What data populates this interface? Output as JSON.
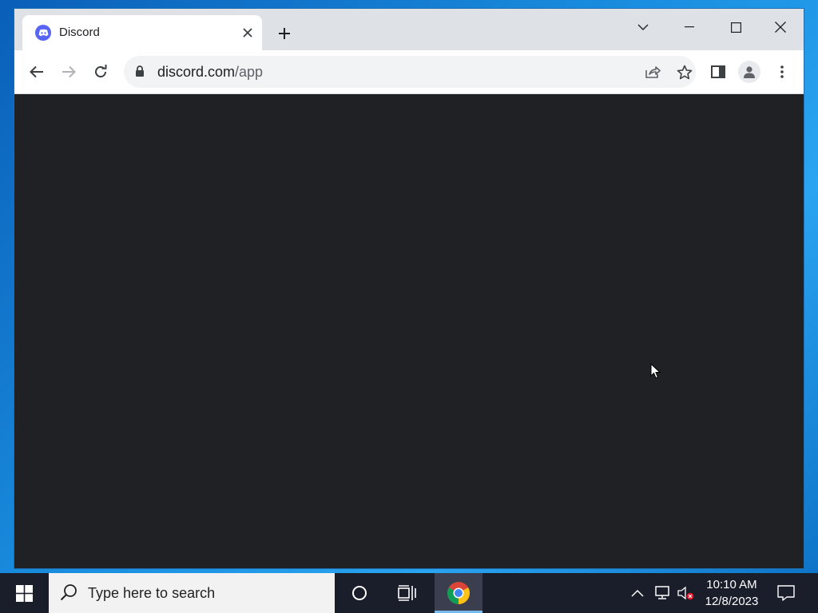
{
  "browser": {
    "tab": {
      "title": "Discord",
      "favicon": "discord-icon"
    },
    "new_tab_icon": "plus-icon",
    "window_controls": [
      "tab-search-chevron-icon",
      "minimize-icon",
      "maximize-icon",
      "close-icon"
    ],
    "address": {
      "domain": "discord.com",
      "path": "/app"
    },
    "toolbar_icons": [
      "back-arrow-icon",
      "forward-arrow-icon",
      "reload-icon",
      "share-icon",
      "bookmark-star-icon",
      "side-panel-icon",
      "profile-icon",
      "menu-dots-icon"
    ],
    "page_background": "#202124"
  },
  "taskbar": {
    "search_placeholder": "Type here to search",
    "pinned": [
      "cortana-icon",
      "task-view-icon",
      "chrome-icon"
    ],
    "time": "10:10 AM",
    "date": "12/8/2023",
    "tray_icons": [
      "show-hidden-icons-chevron",
      "network-icon",
      "volume-muted-icon",
      "notifications-icon"
    ]
  }
}
